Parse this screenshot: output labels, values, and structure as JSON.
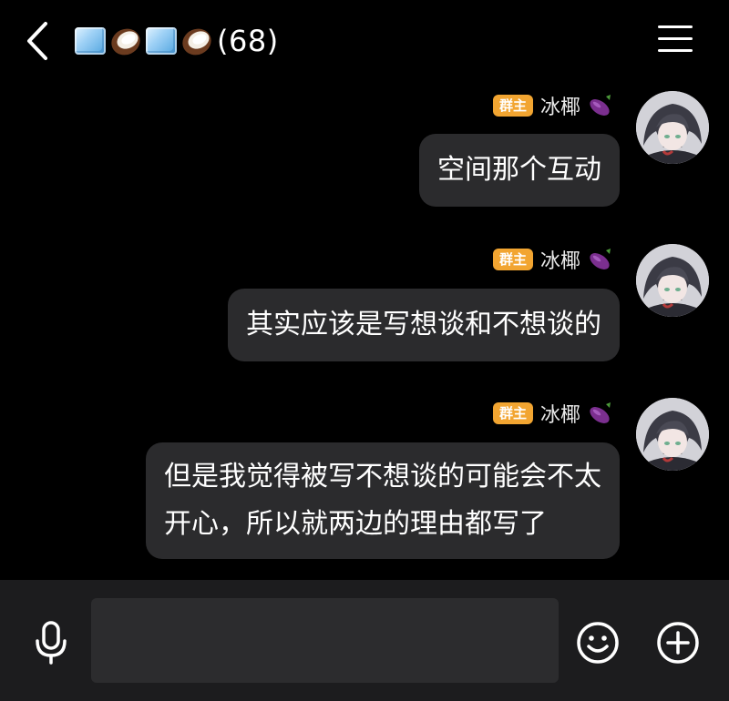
{
  "header": {
    "title_count": "(68)",
    "title_emojis": [
      "ice-cube",
      "coconut",
      "ice-cube",
      "coconut"
    ],
    "back_icon": "chevron-left-icon",
    "menu_icon": "hamburger-menu-icon"
  },
  "messages": [
    {
      "badge": "群主",
      "sender": "冰椰",
      "sender_emoji": "eggplant",
      "text": "空间那个互动"
    },
    {
      "badge": "群主",
      "sender": "冰椰",
      "sender_emoji": "eggplant",
      "text": "其实应该是写想谈和不想谈的"
    },
    {
      "badge": "群主",
      "sender": "冰椰",
      "sender_emoji": "eggplant",
      "text_line1": "但是我觉得被写不想谈的可能会不太",
      "text_line2": "开心，所以就两边的理由都写了"
    }
  ],
  "input_bar": {
    "value": "",
    "placeholder": "",
    "icons": [
      "microphone-icon",
      "emoji-icon",
      "plus-icon"
    ]
  },
  "colors": {
    "background": "#000000",
    "bubble": "#2b2b2d",
    "badge": "#f2a531",
    "input_bar": "#1c1c1e",
    "input_field": "#2c2c2e"
  }
}
